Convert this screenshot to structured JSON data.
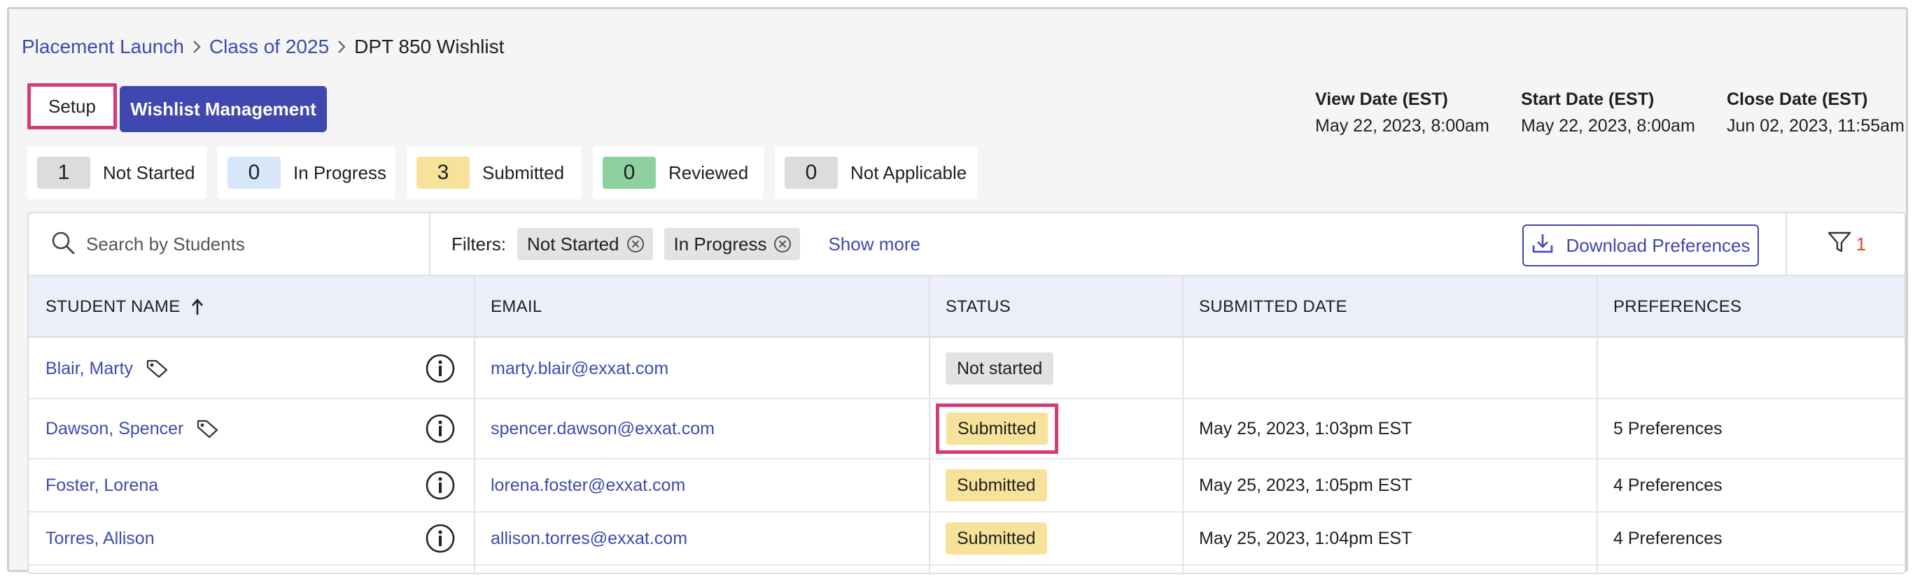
{
  "breadcrumb": {
    "items": [
      "Placement Launch",
      "Class of 2025"
    ],
    "current": "DPT 850 Wishlist"
  },
  "tabs": {
    "setup": "Setup",
    "wishlist": "Wishlist Management"
  },
  "dates": [
    {
      "label": "View Date (EST)",
      "value": "May 22, 2023, 8:00am"
    },
    {
      "label": "Start Date (EST)",
      "value": "May 22, 2023, 8:00am"
    },
    {
      "label": "Close Date (EST)",
      "value": "Jun 02, 2023, 11:55am"
    }
  ],
  "status_cards": [
    {
      "count": "1",
      "label": "Not Started",
      "color": "#dcdcdc"
    },
    {
      "count": "0",
      "label": "In Progress",
      "color": "#d8e6fa"
    },
    {
      "count": "3",
      "label": "Submitted",
      "color": "#f6e29a"
    },
    {
      "count": "0",
      "label": "Reviewed",
      "color": "#8fd19e"
    },
    {
      "count": "0",
      "label": "Not Applicable",
      "color": "#dcdcdc"
    }
  ],
  "toolbar": {
    "search_placeholder": "Search by Students",
    "filters_label": "Filters:",
    "filter_chips": [
      "Not Started",
      "In Progress"
    ],
    "show_more": "Show more",
    "download": "Download Preferences",
    "filter_count": "1"
  },
  "table": {
    "headers": [
      "STUDENT NAME",
      "EMAIL",
      "STATUS",
      "SUBMITTED DATE",
      "PREFERENCES"
    ],
    "rows": [
      {
        "name": "Blair, Marty",
        "tag": true,
        "email": "marty.blair@exxat.com",
        "status": "Not started",
        "date": "",
        "prefs": ""
      },
      {
        "name": "Dawson, Spencer",
        "tag": true,
        "email": "spencer.dawson@exxat.com",
        "status": "Submitted",
        "date": "May 25, 2023, 1:03pm EST",
        "prefs": "5 Preferences"
      },
      {
        "name": "Foster, Lorena",
        "tag": false,
        "email": "lorena.foster@exxat.com",
        "status": "Submitted",
        "date": "May 25, 2023, 1:05pm EST",
        "prefs": "4 Preferences"
      },
      {
        "name": "Torres, Allison",
        "tag": false,
        "email": "allison.torres@exxat.com",
        "status": "Submitted",
        "date": "May 25, 2023, 1:04pm EST",
        "prefs": "4 Preferences"
      }
    ]
  }
}
